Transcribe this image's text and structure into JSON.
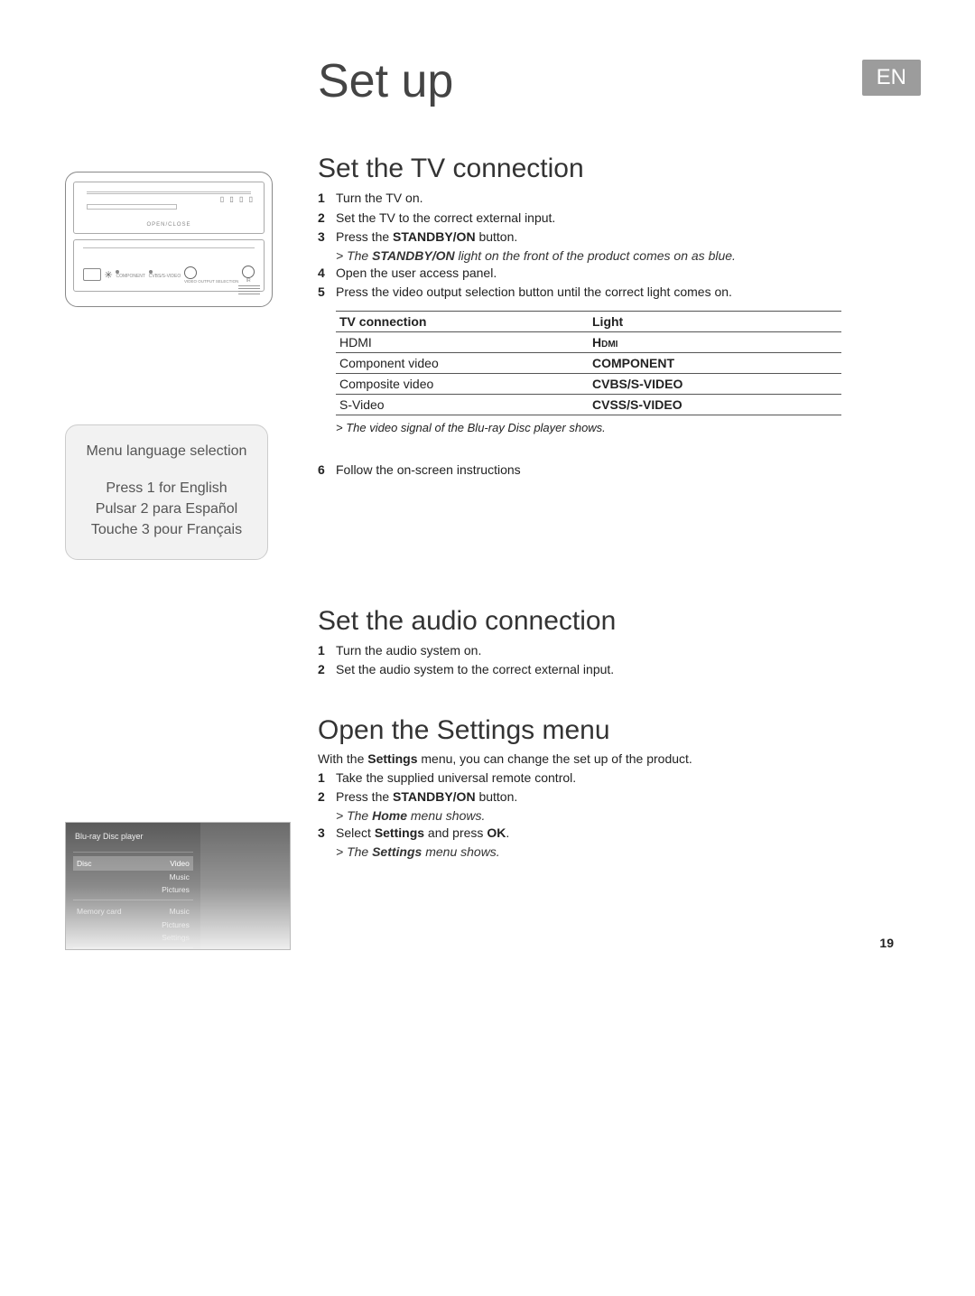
{
  "page_title": "Set up",
  "lang_tag": "EN",
  "page_number": "19",
  "section_tv": {
    "heading": "Set the TV connection",
    "steps": [
      {
        "num": "1",
        "text": "Turn the TV on."
      },
      {
        "num": "2",
        "text": "Set the TV to the correct external input."
      },
      {
        "num": "3",
        "pre": "Press the ",
        "bold": "STANDBY/ON",
        "post": " button."
      },
      {
        "note_pre": "The ",
        "note_bold": "STANDBY/ON",
        "note_post": " light on the front of the product comes on as blue."
      },
      {
        "num": "4",
        "text": "Open the user access panel."
      },
      {
        "num": "5",
        "text": "Press the video output selection button until the correct light comes on."
      }
    ],
    "table": {
      "head_conn": "TV connection",
      "head_light": "Light",
      "rows": [
        {
          "conn": "HDMI",
          "light": "Hdmi"
        },
        {
          "conn": "Component video",
          "light": "COMPONENT"
        },
        {
          "conn": "Composite video",
          "light": "CVBS/S-VIDEO"
        },
        {
          "conn": "S-Video",
          "light": "CVSS/S-VIDEO"
        }
      ],
      "note": "The video signal of the Blu-ray Disc player shows."
    },
    "step6": {
      "num": "6",
      "text": "Follow the on-screen instructions"
    }
  },
  "section_audio": {
    "heading": "Set the audio connection",
    "steps": [
      {
        "num": "1",
        "text": "Turn the audio system on."
      },
      {
        "num": "2",
        "text": "Set the audio system to the correct external input."
      }
    ]
  },
  "section_settings": {
    "heading": "Open the Settings menu",
    "intro_pre": "With the ",
    "intro_bold": "Settings",
    "intro_post": " menu, you can change the set up of the product.",
    "steps": {
      "s1": {
        "num": "1",
        "text": "Take the supplied universal remote control."
      },
      "s2": {
        "num": "2",
        "pre": "Press the ",
        "bold": "STANDBY/ON",
        "post": " button."
      },
      "n2_pre": "The ",
      "n2_bold": "Home",
      "n2_post": " menu shows.",
      "s3": {
        "num": "3",
        "pre": "Select ",
        "bold1": "Settings",
        "mid": " and press ",
        "bold2": "OK",
        "post": "."
      },
      "n3_pre": "The ",
      "n3_bold": "Settings",
      "n3_post": " menu shows."
    }
  },
  "menu_lang": {
    "title": "Menu language selection",
    "l1": "Press 1 for English",
    "l2": "Pulsar 2 para Español",
    "l3": "Touche 3 pour Français"
  },
  "player_diagram": {
    "open_label": "OPEN/CLOSE",
    "icons": "▯ ▯ ▯ ▯",
    "btn_labels": {
      "component": "COMPONENT",
      "cvbs": "CVBS/S-VIDEO",
      "vout": "VIDEO OUTPUT\nSELECTION",
      "ir": "IR"
    }
  },
  "screen": {
    "title": "Blu-ray Disc player",
    "rows": {
      "disc": "Disc",
      "video": "Video",
      "music": "Music",
      "pictures": "Pictures",
      "memcard": "Memory card",
      "music2": "Music",
      "pictures2": "Pictures",
      "settings": "Settings"
    }
  }
}
